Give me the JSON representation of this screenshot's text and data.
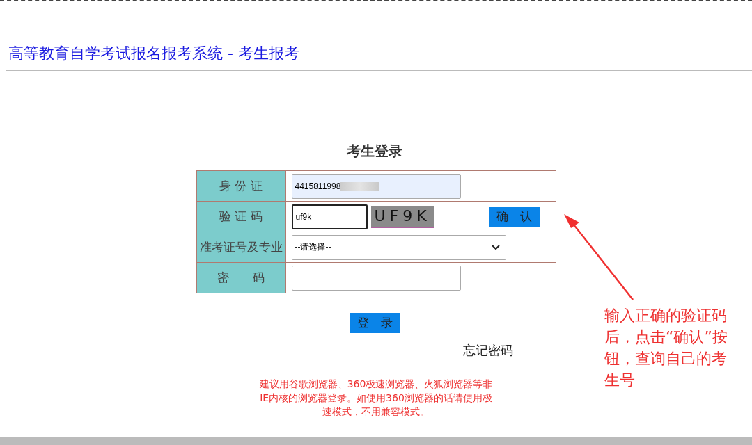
{
  "header": {
    "title": "高等教育自学考试报名报考系统 - 考生报考"
  },
  "login": {
    "heading": "考生登录",
    "rows": [
      {
        "kind": "text",
        "label": "身 份 证",
        "value": "4415811998"
      },
      {
        "kind": "captcha",
        "label": "验 证 码",
        "value": "uf9k",
        "captcha": "UF9K",
        "button": "确　认"
      },
      {
        "kind": "select",
        "label": "准考证号及专业",
        "value": "--请选择--"
      },
      {
        "kind": "password",
        "label": "密　　码",
        "value": ""
      }
    ],
    "submit": "登　录",
    "forgot": "忘记密码",
    "notice": "建议用谷歌浏览器、360极速浏览器、火狐浏览器等非IE内核的浏览器登录。如使用360浏览器的话请使用极速模式，不用兼容模式。"
  },
  "annotation": {
    "text": "输入正确的验证码后，点击“确认”按钮，查询自己的考生号"
  }
}
